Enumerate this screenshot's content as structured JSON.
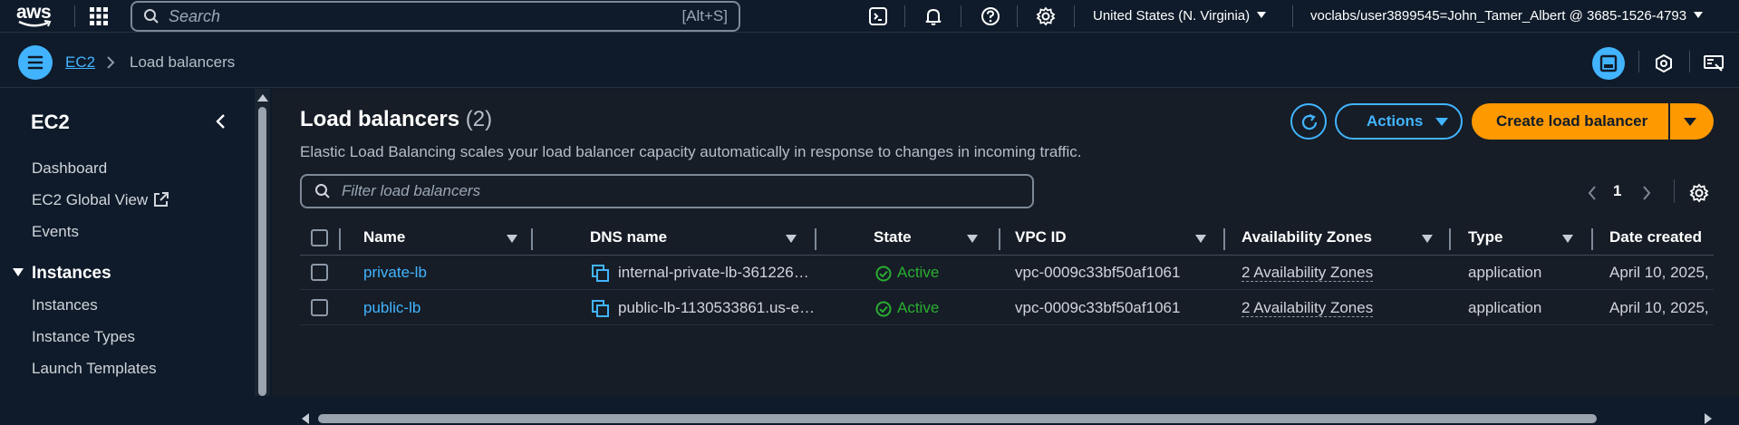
{
  "topbar": {
    "logo_text": "aws",
    "search_placeholder": "Search",
    "search_shortcut": "[Alt+S]",
    "region": "United States (N. Virginia)",
    "account": "voclabs/user3899545=John_Tamer_Albert @ 3685-1526-4793"
  },
  "breadcrumb": {
    "service": "EC2",
    "current": "Load balancers"
  },
  "sidebar": {
    "title": "EC2",
    "items_top": [
      "Dashboard",
      "EC2 Global View",
      "Events"
    ],
    "section_instances": "Instances",
    "items_instances": [
      "Instances",
      "Instance Types",
      "Launch Templates"
    ]
  },
  "main": {
    "title": "Load balancers",
    "count": "(2)",
    "description": "Elastic Load Balancing scales your load balancer capacity automatically in response to changes in incoming traffic.",
    "actions_label": "Actions",
    "create_label": "Create load balancer",
    "filter_placeholder": "Filter load balancers",
    "page_number": "1"
  },
  "table": {
    "columns": [
      "Name",
      "DNS name",
      "State",
      "VPC ID",
      "Availability Zones",
      "Type",
      "Date created"
    ],
    "rows": [
      {
        "name": "private-lb",
        "dns": "internal-private-lb-361226…",
        "state": "Active",
        "vpc": "vpc-0009c33bf50af1061",
        "az": "2 Availability Zones",
        "type": "application",
        "date": "April 10, 2025,"
      },
      {
        "name": "public-lb",
        "dns": "public-lb-1130533861.us-e…",
        "state": "Active",
        "vpc": "vpc-0009c33bf50af1061",
        "az": "2 Availability Zones",
        "type": "application",
        "date": "April 10, 2025,"
      }
    ]
  },
  "colors": {
    "accent": "#42b4ff",
    "primary_button": "#ff9900",
    "status_active": "#29ad32",
    "background": "#0f1b2a"
  },
  "icons": [
    "aws-logo",
    "apps-grid-icon",
    "search-icon",
    "cloudshell-icon",
    "bell-icon",
    "help-icon",
    "gear-icon",
    "menu-icon",
    "chevron-right-icon",
    "split-panel-icon",
    "notifications-icon",
    "layout-icon",
    "chevron-left-icon",
    "external-link-icon",
    "refresh-icon",
    "copy-icon",
    "check-circle-icon"
  ]
}
